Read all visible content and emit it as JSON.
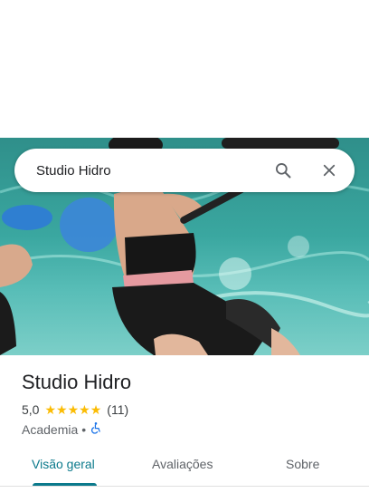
{
  "search": {
    "query": "Studio Hidro"
  },
  "place": {
    "name": "Studio Hidro",
    "rating": "5,0",
    "stars": 5,
    "review_count": "(11)",
    "category": "Academia",
    "separator": "•",
    "accessibility_icon": "wheelchair-icon"
  },
  "tabs": [
    {
      "label": "Visão geral",
      "active": true
    },
    {
      "label": "Avaliações",
      "active": false
    },
    {
      "label": "Sobre",
      "active": false
    }
  ],
  "colors": {
    "accent": "#0b7a8c",
    "star": "#fbbc04",
    "accessibility": "#1a73e8"
  }
}
